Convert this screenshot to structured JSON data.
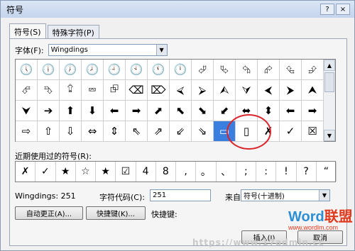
{
  "window": {
    "title": "符号",
    "help_btn": "?",
    "close_btn": "×"
  },
  "tabs": [
    {
      "label": "符号(S)"
    },
    {
      "label": "特殊字符(P)"
    }
  ],
  "font": {
    "label": "字体(F):",
    "value": "Wingdings"
  },
  "grid": {
    "rows": [
      [
        "🕔",
        "🕕",
        "🕖",
        "🕗",
        "🕘",
        "🕙",
        "🕚",
        "🕛",
        "⮰",
        "⮱",
        "⮲",
        "⮳",
        "⮴",
        "⮵"
      ],
      [
        "⮶",
        "⮷",
        "⮸",
        "⮹",
        "⮺",
        "⌫",
        "⌦",
        "⮘",
        "⮚",
        "⮙",
        "⮛",
        "⮜",
        "⮞",
        "⮝"
      ],
      [
        "⮟",
        "➔",
        "⬆",
        "⬇",
        "⬅",
        "➡",
        "⬈",
        "⬉",
        "⬊",
        "⬋",
        "⬌",
        "⬍",
        "⬅",
        "➡"
      ],
      [
        "⇨",
        "⇧",
        "⇩",
        "⇔",
        "⇕",
        "⇖",
        "⇗",
        "⇙",
        "⇘",
        "▭",
        "▯",
        "✗",
        "✓",
        "☒",
        "☑",
        "⊞"
      ]
    ],
    "selected_index": 9
  },
  "recent": {
    "label": "近期使用过的符号(R):",
    "symbols": [
      "✗",
      "✓",
      "★",
      "☆",
      "★",
      "☑",
      "4",
      "8",
      ",",
      "。",
      "、",
      ";",
      ":",
      "!",
      "?",
      "“"
    ]
  },
  "info": {
    "font_code": "Wingdings: 251",
    "char_code_label": "字符代码(C):",
    "char_code_value": "251",
    "from_label": "来自(M):",
    "from_value": "符号(十进制)"
  },
  "buttons": {
    "autocorrect": "自动更正(A)...",
    "shortcut_key": "快捷键(K)...",
    "shortcut_label": "快捷键:",
    "insert": "插入(I)",
    "cancel": "取消"
  },
  "watermark": {
    "line1": "Word",
    "line1_accent": "联盟",
    "line2": "www.wordlm.com"
  },
  "bottom_url": "https://www.17admin.cc"
}
